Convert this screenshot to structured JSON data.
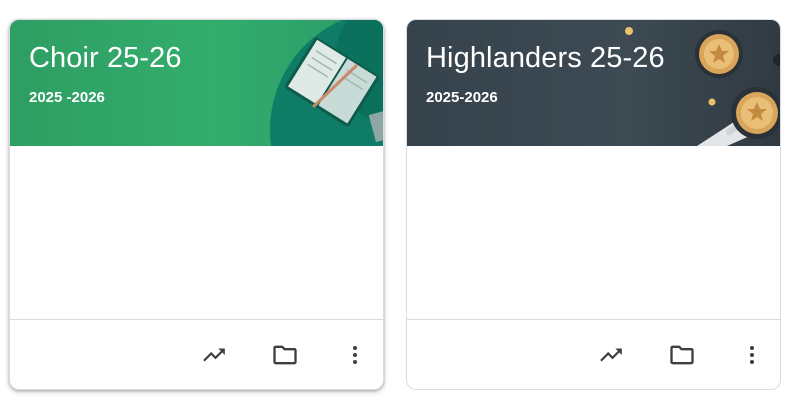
{
  "classes": [
    {
      "title": "Choir 25-26",
      "subtitle": "2025 -2026",
      "theme_color": "#33ad6c",
      "actions": [
        {
          "icon": "trending-up-icon",
          "label": "Open your work"
        },
        {
          "icon": "folder-icon",
          "label": "Open folder"
        },
        {
          "icon": "more-vert-icon",
          "label": "More options"
        }
      ]
    },
    {
      "title": "Highlanders 25-26",
      "subtitle": "2025-2026",
      "theme_color": "#3d4a53",
      "actions": [
        {
          "icon": "trending-up-icon",
          "label": "Open your work"
        },
        {
          "icon": "folder-icon",
          "label": "Open folder"
        },
        {
          "icon": "more-vert-icon",
          "label": "More options"
        }
      ]
    }
  ]
}
